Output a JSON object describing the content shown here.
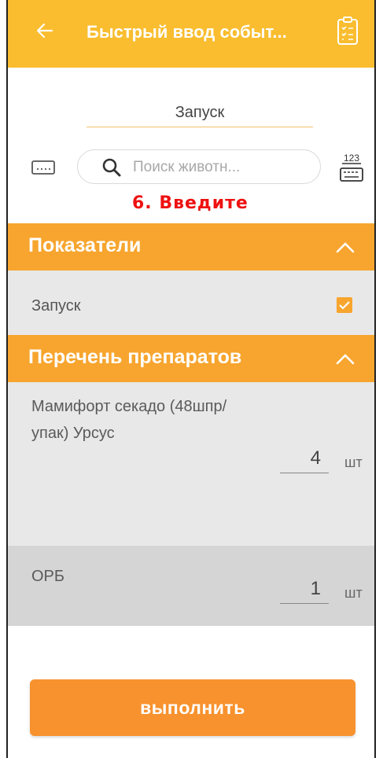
{
  "header": {
    "title": "Быстрый ввод событ...",
    "back_icon": "arrow-left-icon",
    "right_icon": "clipboard-list-icon",
    "color": "#f9bd2f"
  },
  "operation": {
    "value": "Запуск"
  },
  "search": {
    "placeholder": "Поиск животн...",
    "keyboard_icon": "keyboard-icon",
    "numeric_label": "123"
  },
  "hint": "6. Введите",
  "indicators": {
    "title": "Показатели",
    "items": [
      {
        "label": "Запуск",
        "checked": true
      }
    ]
  },
  "drugs": {
    "title": "Перечень препаратов",
    "items": [
      {
        "name": "Мамифорт секадо (48шпр/упак) Урсус",
        "qty": "4",
        "unit": "шт"
      },
      {
        "name": "ОРБ",
        "qty": "1",
        "unit": "шт"
      }
    ]
  },
  "execute_label": "выполнить",
  "colors": {
    "accent": "#f7a52e",
    "button": "#f7922e",
    "hint": "#ee1111"
  }
}
